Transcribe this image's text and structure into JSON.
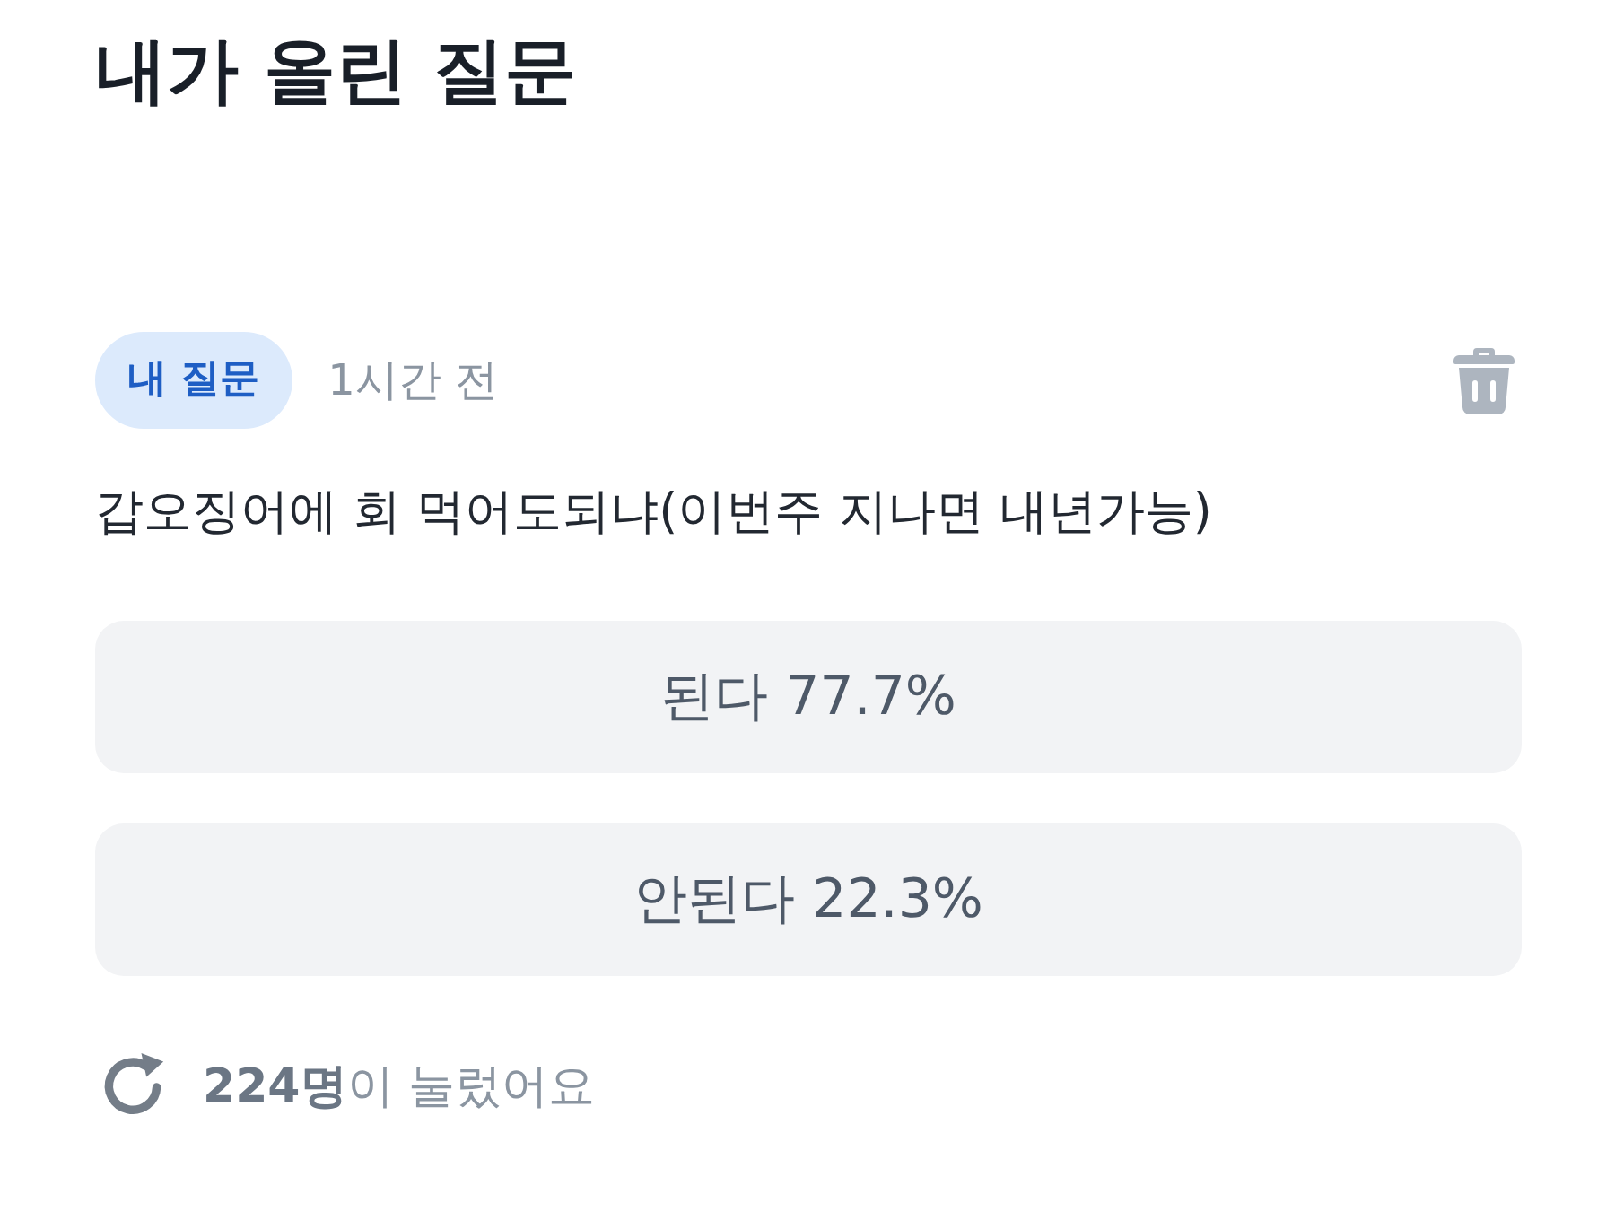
{
  "page": {
    "title": "내가 올린 질문"
  },
  "question": {
    "badge": "내 질문",
    "time": "1시간 전",
    "text": "갑오징어에 회 먹어도되냐(이번주 지나면 내년가능)",
    "options": [
      {
        "label": "된다 77.7%"
      },
      {
        "label": "안된다 22.3%"
      }
    ],
    "footer": "**224명**이 눌렀어요"
  }
}
